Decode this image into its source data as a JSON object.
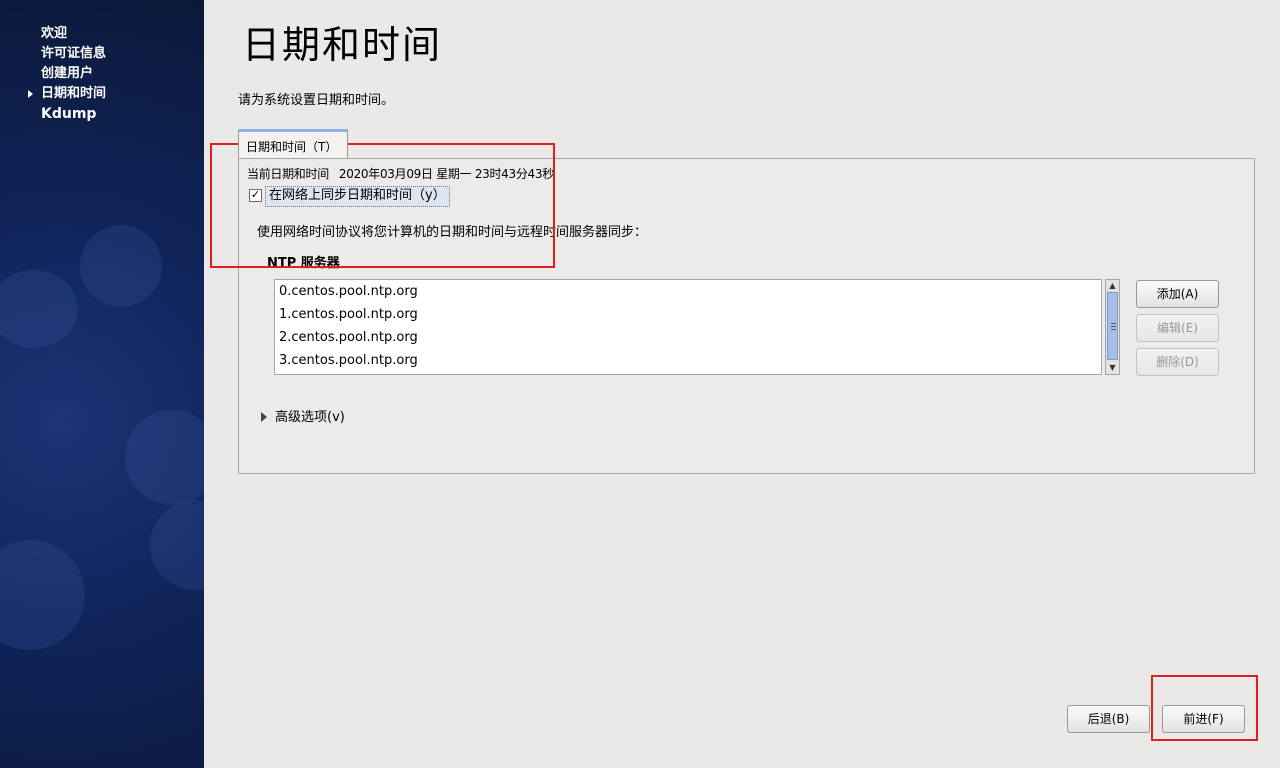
{
  "sidebar": {
    "items": [
      {
        "label": "欢迎",
        "current": false
      },
      {
        "label": "许可证信息",
        "current": false
      },
      {
        "label": "创建用户",
        "current": false
      },
      {
        "label": "日期和时间",
        "current": true
      },
      {
        "label": "Kdump",
        "current": false
      }
    ]
  },
  "main": {
    "title": "日期和时间",
    "intro": "请为系统设置日期和时间。",
    "tab_label": "日期和时间（T）",
    "current_datetime_label": "当前日期和时间",
    "current_datetime_value": "2020年03月09日  星期一  23时43分43秒",
    "sync_checkbox_label": "在网络上同步日期和时间（y）",
    "sync_checked": true,
    "ntp_description": "使用网络时间协议将您计算机的日期和时间与远程时间服务器同步：",
    "ntp_heading": "NTP 服务器",
    "ntp_servers": [
      "0.centos.pool.ntp.org",
      "1.centos.pool.ntp.org",
      "2.centos.pool.ntp.org",
      "3.centos.pool.ntp.org"
    ],
    "add_button": "添加(A)",
    "edit_button": "编辑(E)",
    "delete_button": "删除(D)",
    "advanced_label": "高级选项(v)"
  },
  "footer": {
    "back_button": "后退(B)",
    "forward_button": "前进(F)"
  },
  "colors": {
    "sidebar_bg": "#10245a",
    "highlight": "#e0201f",
    "tab_accent": "#8fb2e3"
  }
}
